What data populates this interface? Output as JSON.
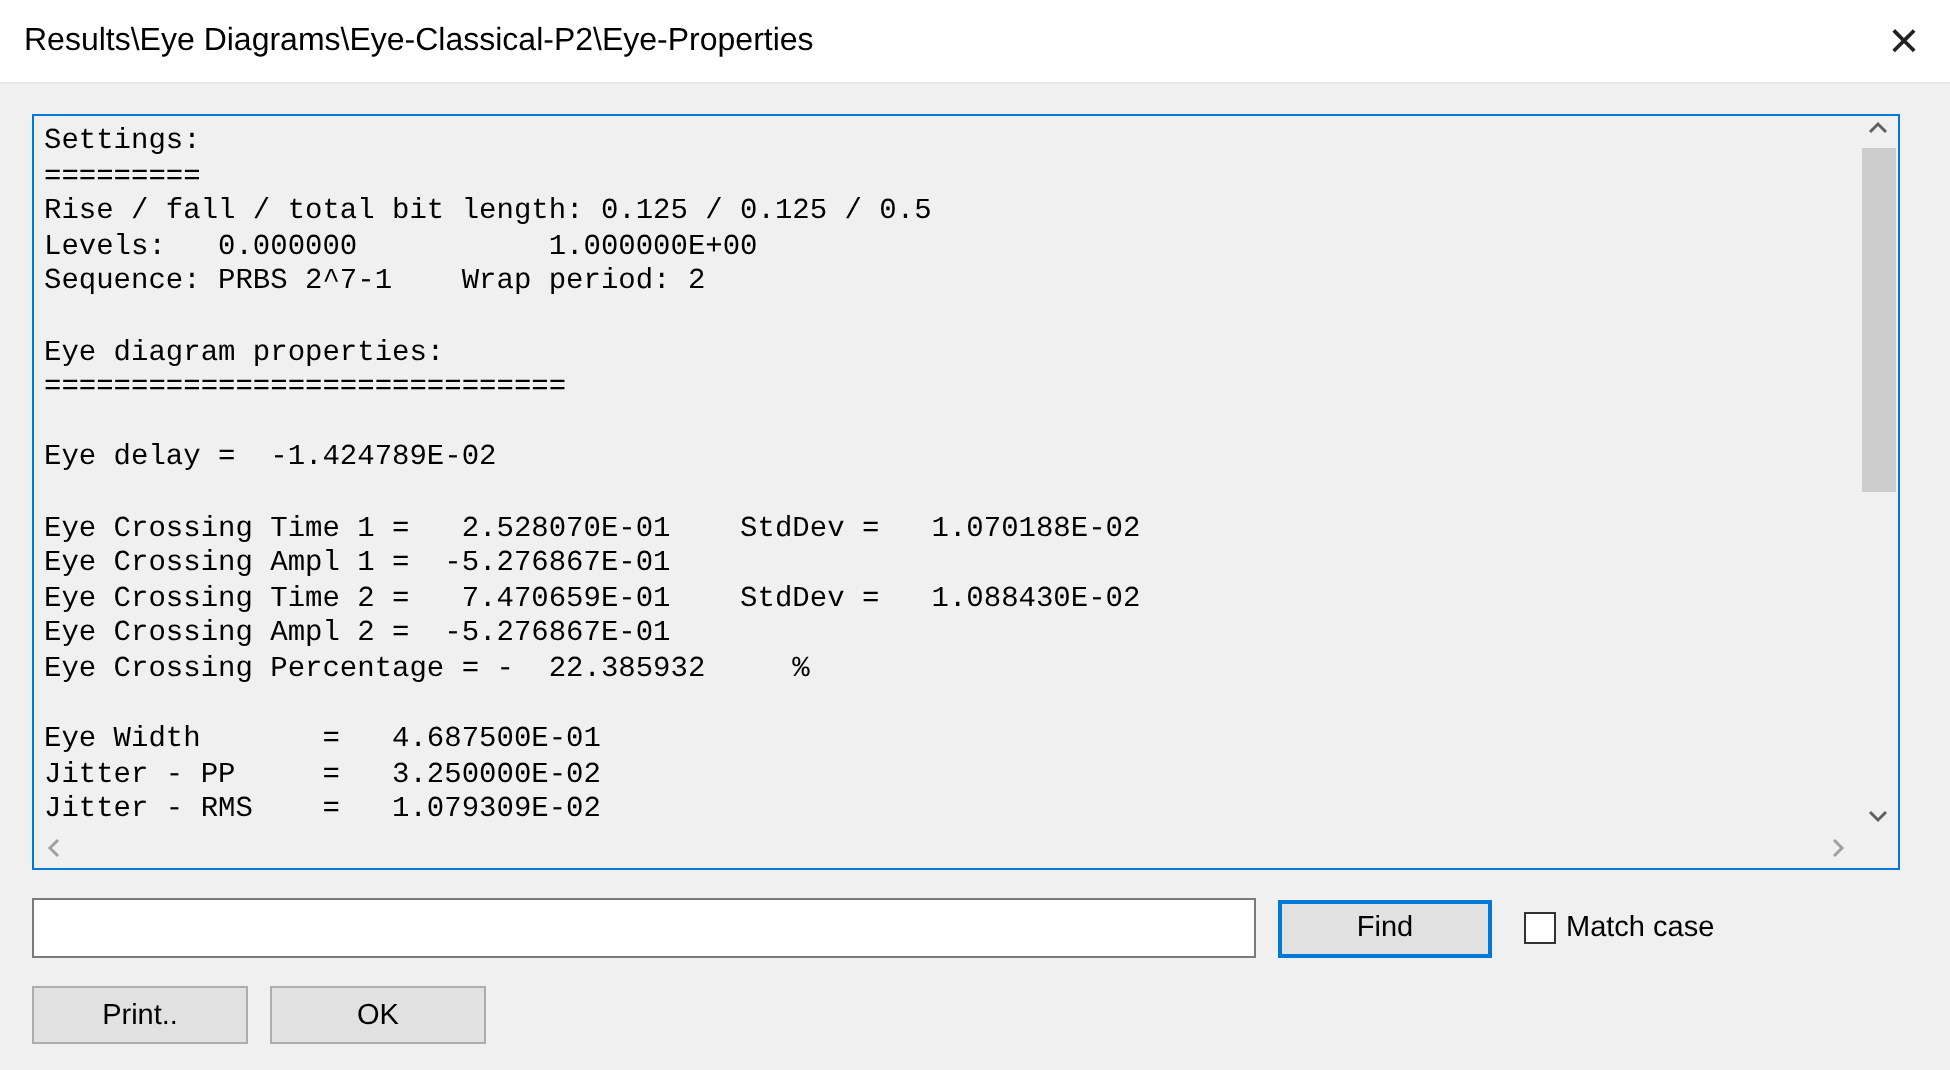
{
  "window": {
    "title": "Results\\Eye Diagrams\\Eye-Classical-P2\\Eye-Properties",
    "close": "×"
  },
  "output": {
    "blocks": [
      [
        "Settings:",
        "=========",
        "Rise / fall / total bit length: 0.125 / 0.125 / 0.5",
        "Levels:   0.000000           1.000000E+00",
        "Sequence: PRBS 2^7-1    Wrap period: 2"
      ],
      [
        "Eye diagram properties:",
        "=============================="
      ],
      [
        "Eye delay =  -1.424789E-02"
      ],
      [
        "Eye Crossing Time 1 =   2.528070E-01    StdDev =   1.070188E-02",
        "Eye Crossing Ampl 1 =  -5.276867E-01",
        "Eye Crossing Time 2 =   7.470659E-01    StdDev =   1.088430E-02",
        "Eye Crossing Ampl 2 =  -5.276867E-01",
        "Eye Crossing Percentage = -  22.385932     %"
      ],
      [
        "Eye Width       =   4.687500E-01",
        "Jitter - PP     =   3.250000E-02",
        "Jitter - RMS    =   1.079309E-02"
      ]
    ]
  },
  "find": {
    "button": "Find",
    "match_case": {
      "label": "Match case",
      "checked": false
    }
  },
  "buttons": [
    "Print..",
    "OK"
  ]
}
